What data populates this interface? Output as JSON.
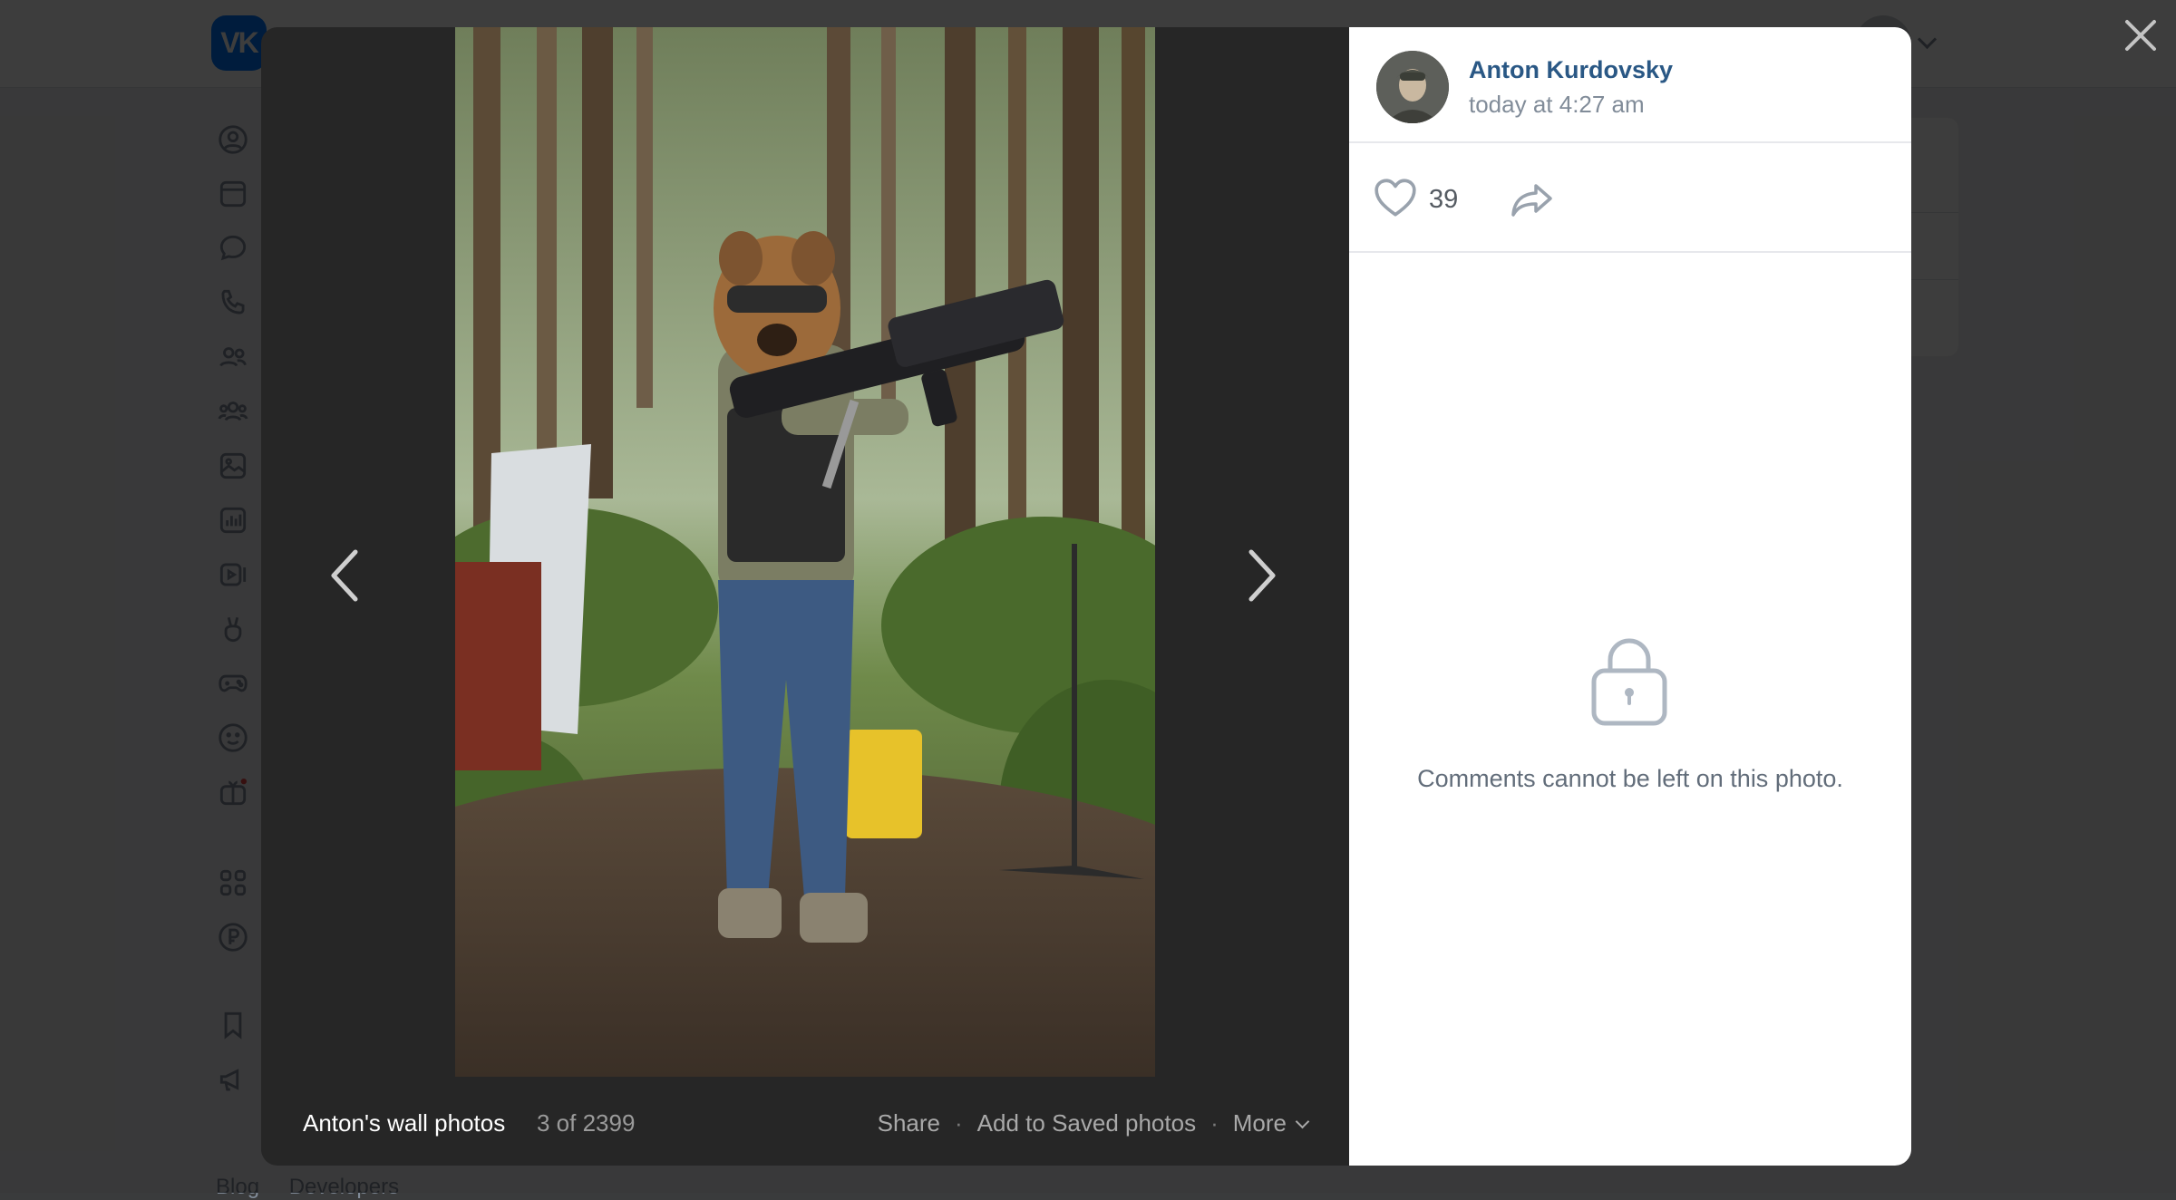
{
  "viewer": {
    "album_title": "Anton's wall photos",
    "counter": "3 of 2399",
    "actions": {
      "share": "Share",
      "add_to_saved": "Add to Saved photos",
      "more": "More"
    }
  },
  "author": {
    "name": "Anton Kurdovsky",
    "time": "today at 4:27 am"
  },
  "reactions": {
    "likes": "39"
  },
  "comments_note": "Comments cannot be left on this photo.",
  "background": {
    "logo_text": "VK",
    "footer_links": [
      "Blog",
      "Developers"
    ]
  },
  "colors": {
    "link_blue": "#2a5885",
    "vk_blue": "#0077ff",
    "viewer_bg": "#262626"
  },
  "icons": {
    "sidebar": [
      "profile-icon",
      "news-icon",
      "messages-icon",
      "calls-icon",
      "friends-icon",
      "communities-icon",
      "photos-icon",
      "music-icon",
      "video-icon",
      "clips-icon",
      "games-icon",
      "stickers-icon",
      "gifts-icon",
      "apps-icon",
      "payments-icon",
      "bookmarks-icon",
      "ads-icon"
    ]
  }
}
